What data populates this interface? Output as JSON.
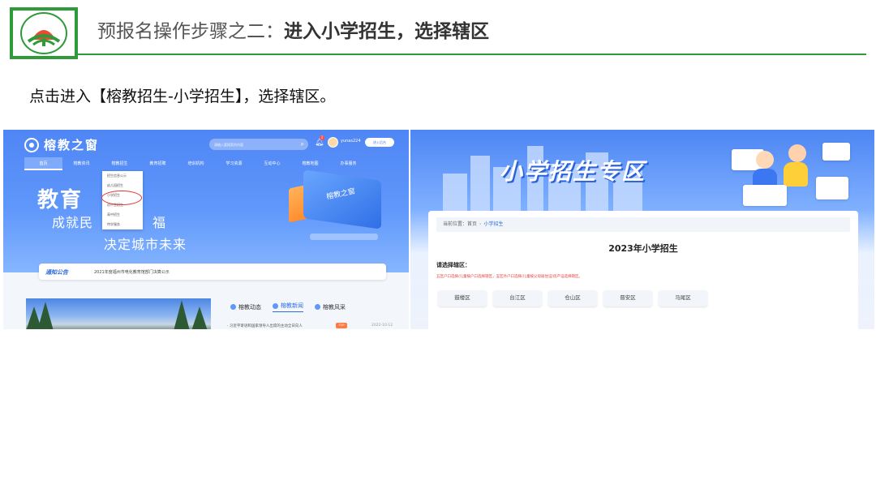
{
  "slide": {
    "title_prefix": "预报名操作步骤之二：",
    "title_emphasis": "进入小学招生，选择辖区",
    "instruction": "点击进入【榕教招生-小学招生】，选择辖区。"
  },
  "colors": {
    "accent_green": "#2f9a3a",
    "portal_blue": "#4f86f5",
    "link_blue": "#2f6fe6",
    "note_red": "#e53935"
  },
  "portal": {
    "brand": "榕教之窗",
    "search_placeholder": "请输入要搜索的内容",
    "username": "yunas224",
    "bell_count": "1",
    "enter_button": "进入后台",
    "nav": [
      "首页",
      "榕教资讯",
      "榕教招生",
      "教育招聘",
      "培训机构",
      "学习资源",
      "互动中心",
      "榕教地图",
      "办事服务"
    ],
    "dropdown": [
      "招生信息公示",
      "幼儿园招生",
      "小学招生",
      "初中生招生",
      "高中招生",
      "特学服务"
    ],
    "hero": {
      "line1": "教育",
      "line2a": "成就民",
      "line2b": "福",
      "line3": "决定城市未来"
    },
    "device_label": "榕教之窗",
    "notice_tag": "通知公告",
    "notice_text": "2021年度福州市电化教育馆部门决算公示",
    "news_tabs": [
      "榕教动态",
      "榕教新闻",
      "榕教风采"
    ],
    "news_row": "· 习近平寄语和国家领导人出席的主动全日向人",
    "news_badge": "TOP",
    "news_date": "2022-10-12"
  },
  "zone": {
    "title": "小学招生专区",
    "breadcrumb_prefix": "当前位置：",
    "breadcrumb_home": "首页",
    "breadcrumb_current": "小学招生",
    "card_title": "2023年小学招生",
    "district_label": "请选择辖区：",
    "note": "五区户口选择/儿童按户口选择辖区，五区外户口选择/儿童按父母居住证/房产证选择辖区。",
    "districts": [
      "鼓楼区",
      "台江区",
      "仓山区",
      "晋安区",
      "马尾区"
    ]
  }
}
